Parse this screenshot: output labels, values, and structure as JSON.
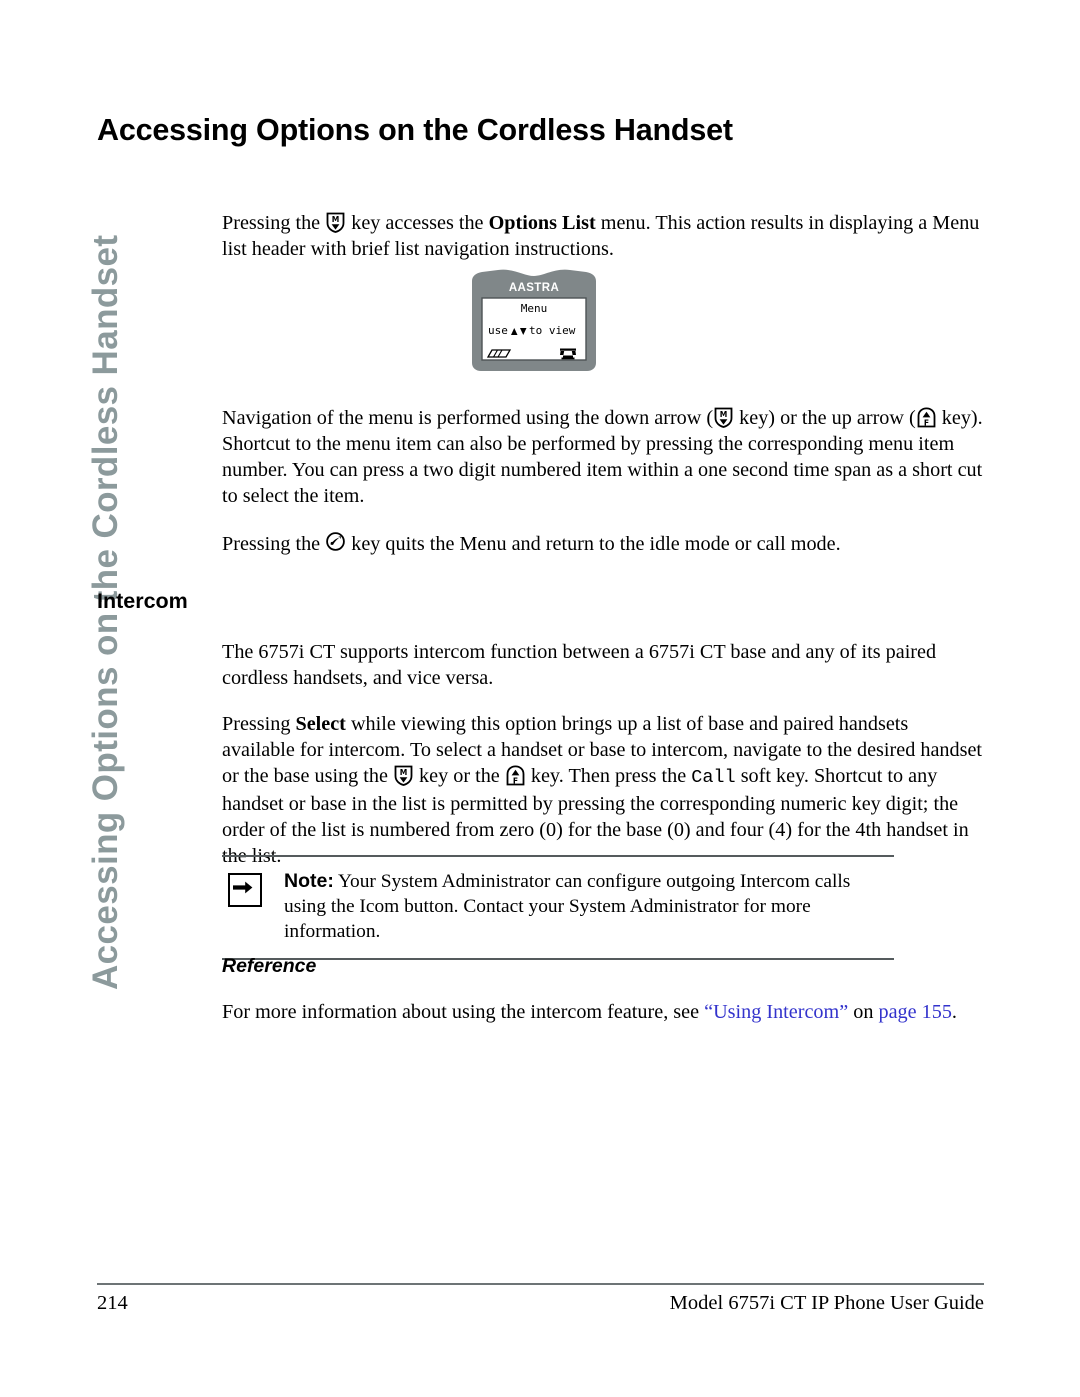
{
  "side_tab": {
    "text": "Accessing Options on the Cordless Handset",
    "color": "#8c9a9c"
  },
  "page_title": "Accessing Options on the Cordless Handset",
  "paragraphs": {
    "intro_a": "Pressing the ",
    "intro_b": " key accesses the ",
    "intro_bold": "Options List",
    "intro_c": " menu. This action results in displaying a Menu list header with brief list navigation instructions.",
    "nav_a": "Navigation of the menu is performed using the down arrow (",
    "nav_b": " key) or the up arrow (",
    "nav_c": " key). Shortcut to the menu item can also be performed by pressing the corresponding menu item number. You can press a two digit numbered item within a one second time span as a short cut to select the item.",
    "quit_a": "Pressing the ",
    "quit_b": " key quits the Menu and return to the idle mode or call mode."
  },
  "intercom": {
    "heading": "Intercom",
    "para1": "The 6757i CT supports intercom function between a 6757i CT base and any of its paired cordless handsets, and vice versa.",
    "para2_a": "Pressing ",
    "para2_bold": "Select",
    "para2_b": " while viewing this option brings up a list of base and paired handsets available for intercom. To select a handset or base to intercom, navigate to the desired handset or the base using the ",
    "para2_c": " key or the ",
    "para2_d": " key. Then press the ",
    "para2_mono": "Call",
    "para2_e": " soft key. Shortcut to any handset or base in the list is permitted by pressing the corresponding numeric key digit; the order of the list is numbered from zero (0) for the base (0) and four (4) for the 4th handset in the list."
  },
  "note": {
    "label": "Note:",
    "text": " Your System Administrator can configure outgoing Intercom calls using the Icom button. Contact your System Administrator for more information.",
    "icon": "right-arrow-icon"
  },
  "reference": {
    "heading": "Reference",
    "text_a": "For more information about using the intercom feature, see ",
    "link_title": "“Using Intercom”",
    "text_b": " on ",
    "link_page": "page 155",
    "text_c": ".",
    "link_color": "#3333cc"
  },
  "handset": {
    "brand": "AASTRA",
    "lcd_line1": "Menu",
    "lcd_line2_pre": "use",
    "lcd_line2_up": "▲",
    "lcd_line2_down": "▼",
    "lcd_line2_post": "to view",
    "softkey_left_icon": "keypad-icon",
    "softkey_right_icon": "telephone-icon",
    "body_color": "#808789",
    "screen_color": "#ffffff"
  },
  "icons": {
    "menu_key": "menu-down-arrow-key-icon",
    "up_key": "up-arrow-feature-key-icon",
    "hangup_key": "hangup-key-icon"
  },
  "footer": {
    "page_number": "214",
    "guide_title": "Model 6757i CT IP Phone User Guide"
  }
}
